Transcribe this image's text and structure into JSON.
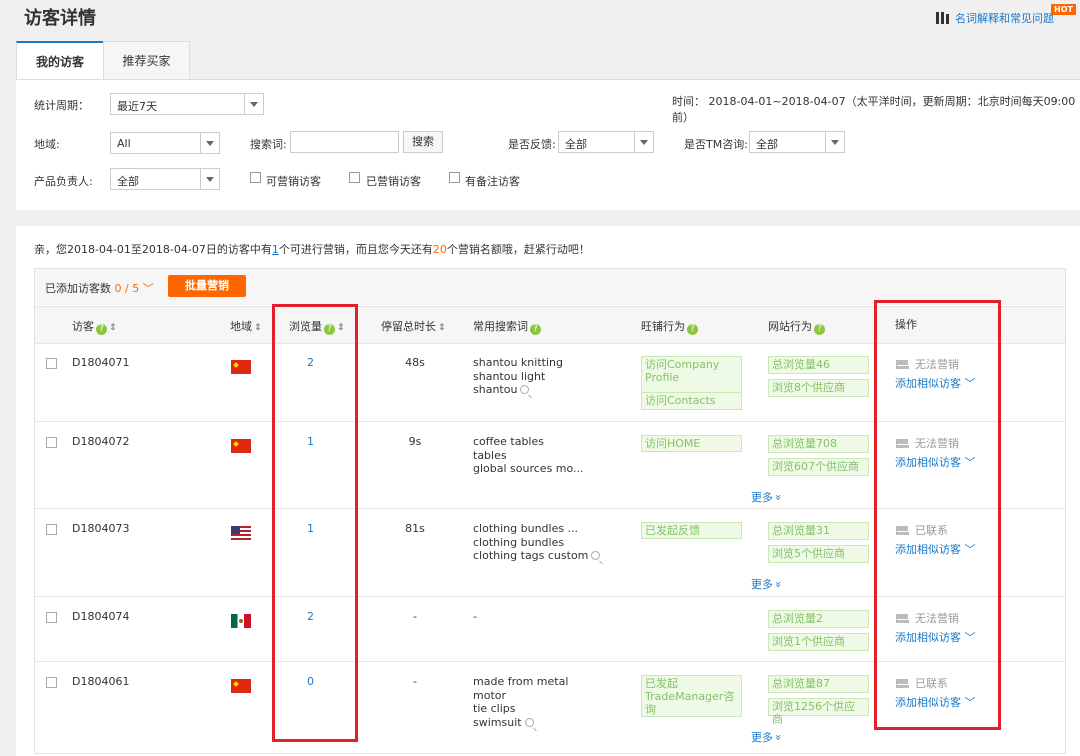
{
  "header": {
    "title": "访客详情",
    "help_link": "名词解释和常见问题",
    "hot_badge": "HOT"
  },
  "tabs": [
    {
      "label": "我的访客"
    },
    {
      "label": "推荐买家"
    }
  ],
  "filters": {
    "period_label": "统计周期：",
    "period_value": "最近7天",
    "time_info": "时间： 2018-04-01~2018-04-07（太平洋时间，更新周期：北京时间每天09:00前）",
    "region_label": "地域:",
    "region_value": "All",
    "search_label": "搜索词:",
    "search_value": "",
    "search_button": "搜索",
    "feedback_label": "是否反馈:",
    "feedback_value": "全部",
    "tm_label": "是否TM咨询:",
    "tm_value": "全部",
    "owner_label": "产品负责人:",
    "owner_value": "全部",
    "chk_marketable": "可营销访客",
    "chk_marketed": "已营销访客",
    "chk_noted": "有备注访客"
  },
  "notice": {
    "p1": "亲，您2018-04-01至2018-04-07日的访客中有",
    "n1": "1",
    "p2": "个可进行营销，而且您今天还有",
    "n2": "20",
    "p3": "个营销名额哦，赶紧行动吧！"
  },
  "toolbar": {
    "added_label": "已添加访客数",
    "added_count": "0 / 5",
    "bulk_button": "批量营销"
  },
  "columns": {
    "visitor": "访客",
    "region": "地域",
    "views": "浏览量",
    "duration": "停留总时长",
    "keywords": "常用搜索词",
    "wangpu": "旺铺行为",
    "site": "网站行为",
    "action": "操作"
  },
  "rows": [
    {
      "id": "D1804071",
      "flag": "cn",
      "views": "2",
      "duration": "48s",
      "kw1": "shantou knitting",
      "kw2": "shantou light",
      "kw3": "shantou",
      "kw4": "",
      "w1": "访问Company Profile",
      "w2": "访问Contacts",
      "s1": "总浏览量46",
      "s2": "浏览8个供应商",
      "status": "无法营销",
      "add": "添加相似访客",
      "more": ""
    },
    {
      "id": "D1804072",
      "flag": "cn",
      "views": "1",
      "duration": "9s",
      "kw1": "coffee tables",
      "kw2": "tables",
      "kw3": "global sources mo...",
      "kw4": "",
      "w1": "访问HOME",
      "w2": "",
      "s1": "总浏览量708",
      "s2": "浏览607个供应商",
      "status": "无法营销",
      "add": "添加相似访客",
      "more": "更多"
    },
    {
      "id": "D1804073",
      "flag": "us",
      "views": "1",
      "duration": "81s",
      "kw1": "clothing bundles ...",
      "kw2": "clothing bundles",
      "kw3": "clothing tags custom",
      "kw4": "",
      "w1": "已发起反馈",
      "w2": "",
      "s1": "总浏览量31",
      "s2": "浏览5个供应商",
      "status": "已联系",
      "add": "添加相似访客",
      "more": "更多"
    },
    {
      "id": "D1804074",
      "flag": "mx",
      "views": "2",
      "duration": "-",
      "kw1": "-",
      "kw2": "",
      "kw3": "",
      "kw4": "",
      "w1": "",
      "w2": "",
      "s1": "总浏览量2",
      "s2": "浏览1个供应商",
      "status": "无法营销",
      "add": "添加相似访客",
      "more": ""
    },
    {
      "id": "D1804061",
      "flag": "cn",
      "views": "0",
      "duration": "-",
      "kw1": "made from metal",
      "kw2": "motor",
      "kw3": "tie clips",
      "kw4": "swimsuit",
      "w1": "已发起TradeManager咨询",
      "w2": "",
      "s1": "总浏览量87",
      "s2": "浏览1256个供应商",
      "status": "已联系",
      "add": "添加相似访客",
      "more": "更多"
    }
  ]
}
